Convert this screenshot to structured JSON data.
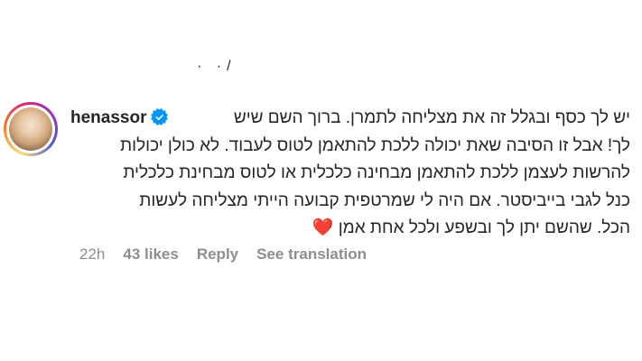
{
  "top_fragment": "· ·/",
  "comment": {
    "username": "henassor",
    "verified_icon": "verified-badge-icon",
    "text_line1": "יש לך כסף ובגלל זה את מצליחה לתמרן. ברוך השם שיש",
    "text_line2": "לך! אבל זו הסיבה שאת יכולה ללכת להתאמן לטוס לעבוד. לא כולן יכולות",
    "text_line3": "להרשות לעצמן ללכת להתאמן מבחינה כלכלית או לטוס מבחינת כלכלית",
    "text_line4": "כנל לגבי בייביסטר. אם היה לי שמרטפית קבועה הייתי מצליחה לעשות",
    "text_line5": "הכל. שהשם יתן לך ובשפע ולכל אחת אמן",
    "heart_emoji": "❤️"
  },
  "meta": {
    "time": "22h",
    "likes": "43 likes",
    "reply": "Reply",
    "translate": "See translation"
  },
  "colors": {
    "text": "#262626",
    "muted": "#8e8e8e",
    "verified": "#0095f6",
    "heart": "#ed1b34"
  }
}
